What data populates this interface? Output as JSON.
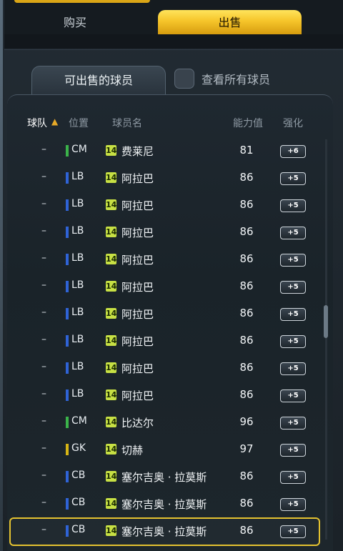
{
  "tabs": {
    "buy": "购买",
    "sell": "出售"
  },
  "subtabs": {
    "sellable": "可出售的球员",
    "view_all": "查看所有球员"
  },
  "columns": {
    "team": "球队",
    "position": "位置",
    "name": "球员名",
    "rating": "能力值",
    "enhance": "强化"
  },
  "sort_indicator": "▲",
  "colors": {
    "position_cm": "#3bb34a",
    "position_lb": "#2f63d6",
    "position_gk": "#d7b515",
    "position_cb": "#2f63d6",
    "accent": "#f6c52a"
  },
  "rows": [
    {
      "team": "–",
      "position": "CM",
      "badge": "14",
      "name": "费莱尼",
      "rating": "81",
      "enhance": "+6"
    },
    {
      "team": "–",
      "position": "LB",
      "badge": "14",
      "name": "阿拉巴",
      "rating": "86",
      "enhance": "+5"
    },
    {
      "team": "–",
      "position": "LB",
      "badge": "14",
      "name": "阿拉巴",
      "rating": "86",
      "enhance": "+5"
    },
    {
      "team": "–",
      "position": "LB",
      "badge": "14",
      "name": "阿拉巴",
      "rating": "86",
      "enhance": "+5"
    },
    {
      "team": "–",
      "position": "LB",
      "badge": "14",
      "name": "阿拉巴",
      "rating": "86",
      "enhance": "+5"
    },
    {
      "team": "–",
      "position": "LB",
      "badge": "14",
      "name": "阿拉巴",
      "rating": "86",
      "enhance": "+5"
    },
    {
      "team": "–",
      "position": "LB",
      "badge": "14",
      "name": "阿拉巴",
      "rating": "86",
      "enhance": "+5"
    },
    {
      "team": "–",
      "position": "LB",
      "badge": "14",
      "name": "阿拉巴",
      "rating": "86",
      "enhance": "+5"
    },
    {
      "team": "–",
      "position": "LB",
      "badge": "14",
      "name": "阿拉巴",
      "rating": "86",
      "enhance": "+5"
    },
    {
      "team": "–",
      "position": "LB",
      "badge": "14",
      "name": "阿拉巴",
      "rating": "86",
      "enhance": "+5"
    },
    {
      "team": "–",
      "position": "CM",
      "badge": "14",
      "name": "比达尔",
      "rating": "96",
      "enhance": "+5"
    },
    {
      "team": "–",
      "position": "GK",
      "badge": "14",
      "name": "切赫",
      "rating": "97",
      "enhance": "+5"
    },
    {
      "team": "–",
      "position": "CB",
      "badge": "14",
      "name": "塞尔吉奥 · 拉莫斯",
      "rating": "86",
      "enhance": "+5"
    },
    {
      "team": "–",
      "position": "CB",
      "badge": "14",
      "name": "塞尔吉奥 · 拉莫斯",
      "rating": "86",
      "enhance": "+5"
    },
    {
      "team": "–",
      "position": "CB",
      "badge": "14",
      "name": "塞尔吉奥 · 拉莫斯",
      "rating": "86",
      "enhance": "+5",
      "selected": true
    }
  ]
}
